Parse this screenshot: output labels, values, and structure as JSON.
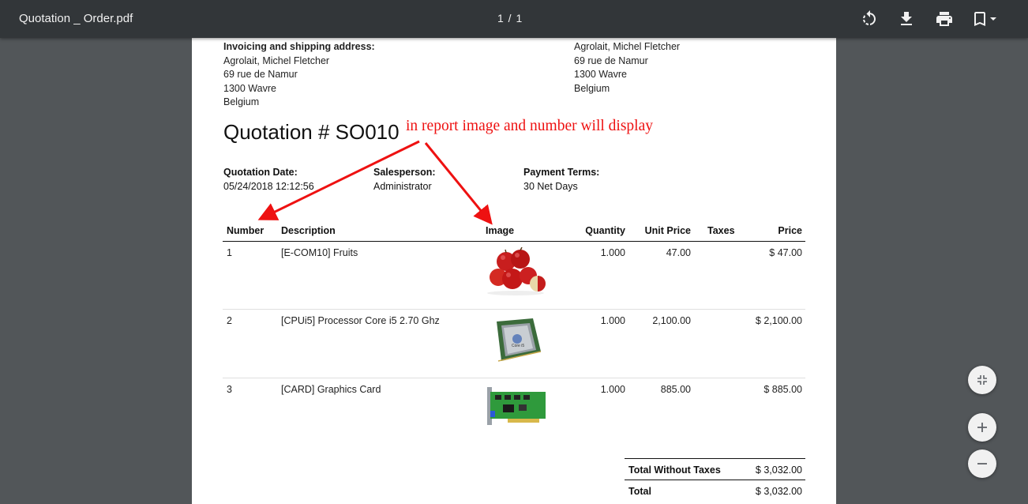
{
  "viewer": {
    "filename": "Quotation _ Order.pdf",
    "page_indicator": "1 / 1",
    "icons": [
      "rotate-icon",
      "download-icon",
      "print-icon",
      "bookmark-icon",
      "fit-to-page-icon",
      "zoom-in-icon",
      "zoom-out-icon"
    ]
  },
  "document": {
    "address_label": "Invoicing and shipping address:",
    "invoice_address": [
      "Agrolait, Michel Fletcher",
      "69 rue de Namur",
      "1300 Wavre",
      "Belgium"
    ],
    "shipping_address": [
      "Agrolait, Michel Fletcher",
      "69 rue de Namur",
      "1300 Wavre",
      "Belgium"
    ],
    "title": "Quotation # SO010",
    "info": {
      "date_label": "Quotation Date:",
      "date_value": "05/24/2018 12:12:56",
      "salesperson_label": "Salesperson:",
      "salesperson_value": "Administrator",
      "terms_label": "Payment Terms:",
      "terms_value": "30 Net Days"
    },
    "table": {
      "headers": [
        "Number",
        "Description",
        "Image",
        "Quantity",
        "Unit Price",
        "Taxes",
        "Price"
      ],
      "rows": [
        {
          "number": "1",
          "description": "[E-COM10] Fruits",
          "image": "apples",
          "quantity": "1.000",
          "unit_price": "47.00",
          "taxes": "",
          "price": "$ 47.00"
        },
        {
          "number": "2",
          "description": "[CPUi5] Processor Core i5 2.70 Ghz",
          "image": "cpu-chip",
          "quantity": "1.000",
          "unit_price": "2,100.00",
          "taxes": "",
          "price": "$ 2,100.00"
        },
        {
          "number": "3",
          "description": "[CARD] Graphics Card",
          "image": "graphics-card",
          "quantity": "1.000",
          "unit_price": "885.00",
          "taxes": "",
          "price": "$ 885.00"
        }
      ]
    },
    "totals": {
      "without_taxes_label": "Total Without Taxes",
      "without_taxes_value": "$ 3,032.00",
      "total_label": "Total",
      "total_value": "$ 3,032.00"
    }
  },
  "annotation": {
    "text": "in report image and number will display",
    "color": "#ee1111"
  },
  "colors": {
    "toolbar_bg": "#323639",
    "viewer_bg": "#525659",
    "page_bg": "#ffffff"
  }
}
